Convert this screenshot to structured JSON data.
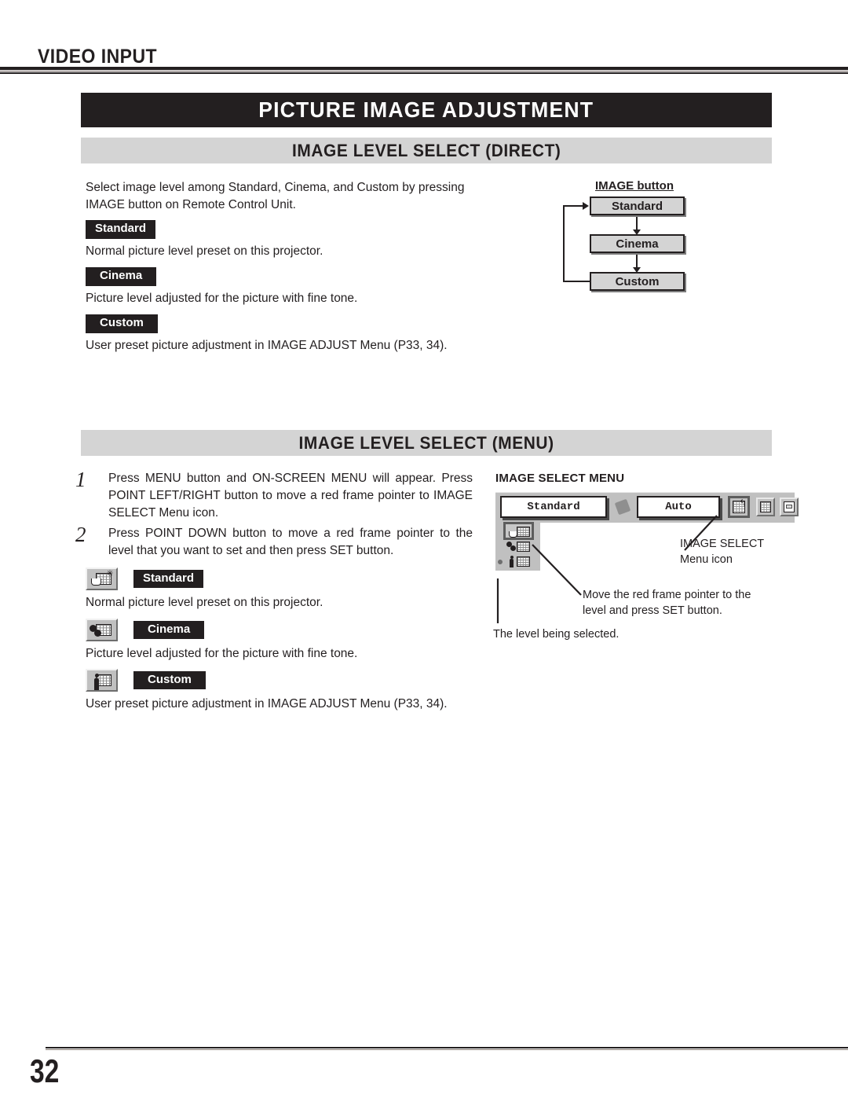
{
  "header": {
    "section_label": "VIDEO INPUT",
    "title": "PICTURE IMAGE ADJUSTMENT"
  },
  "direct_section": {
    "bar_title": "IMAGE LEVEL SELECT (DIRECT)",
    "intro": "Select image level among Standard, Cinema, and Custom by pressing IMAGE button on  Remote Control Unit.",
    "levels": [
      {
        "badge": "Standard",
        "description": "Normal picture level preset on this projector."
      },
      {
        "badge": "Cinema",
        "description": "Picture level adjusted for the picture with fine tone."
      },
      {
        "badge": "Custom",
        "description": "User preset picture adjustment in IMAGE ADJUST Menu (P33, 34)."
      }
    ],
    "flow_diagram": {
      "caption": "IMAGE button",
      "boxes": [
        "Standard",
        "Cinema",
        "Custom"
      ]
    }
  },
  "menu_section": {
    "bar_title": "IMAGE LEVEL SELECT (MENU)",
    "steps": [
      {
        "number": "1",
        "text": "Press MENU button and ON-SCREEN MENU will appear.  Press POINT LEFT/RIGHT button to move a red frame pointer to IMAGE SELECT Menu icon."
      },
      {
        "number": "2",
        "text": "Press POINT DOWN button to move a red frame pointer to the level that you want to set and then press SET button."
      }
    ],
    "levels": [
      {
        "icon": "standard-level-icon",
        "badge": "Standard",
        "description": "Normal picture level preset on this projector."
      },
      {
        "icon": "cinema-level-icon",
        "badge": "Cinema",
        "description": "Picture level adjusted for the picture with fine tone."
      },
      {
        "icon": "custom-level-icon",
        "badge": "Custom",
        "description": "User preset picture adjustment in IMAGE ADJUST Menu (P33, 34)."
      }
    ],
    "screenshot": {
      "title": "IMAGE SELECT MENU",
      "level_value": "Standard",
      "auto_value": "Auto",
      "callouts": [
        {
          "name": "image-select-menu-icon",
          "text": "IMAGE SELECT\nMenu icon",
          "line1": "IMAGE SELECT",
          "line2": "Menu icon"
        },
        {
          "name": "move-pointer-note",
          "line1": "Move the red frame pointer to the",
          "line2": "level and press SET button."
        },
        {
          "name": "level-selected-note",
          "line1": "The level being selected."
        }
      ]
    }
  },
  "footer": {
    "page_number": "32"
  },
  "colors": {
    "ink": "#231f20",
    "bar_gray": "#d4d4d4",
    "chrome_gray": "#c0c0c0"
  }
}
